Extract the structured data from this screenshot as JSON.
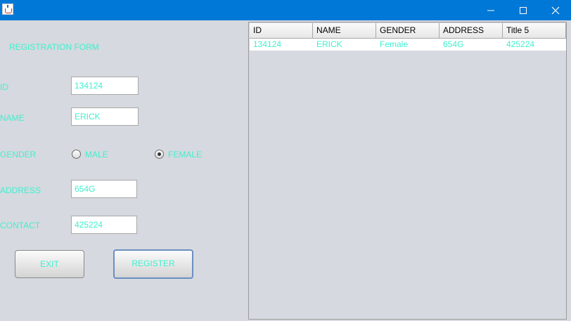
{
  "window": {
    "icons": {
      "app": "java-cup-icon",
      "minimize": "minimize-icon",
      "maximize": "maximize-icon",
      "close": "close-icon"
    }
  },
  "form": {
    "title": "REGISTRATION FORM",
    "id_label": "ID",
    "id_value": "134124",
    "name_label": "NAME",
    "name_value": "ERICK",
    "gender_label": "GENDER",
    "gender_options": [
      "MALE",
      "FEMALE"
    ],
    "gender_selected": "FEMALE",
    "address_label": "ADDRESS",
    "address_value": "654G",
    "contact_label": "CONTACT",
    "contact_value": "425224",
    "exit_label": "EXIT",
    "register_label": "REGISTER"
  },
  "table": {
    "columns": [
      "ID",
      "NAME",
      "GENDER",
      "ADDRESS",
      "Title 5"
    ],
    "rows": [
      [
        "134124",
        "ERICK",
        "Female",
        "654G",
        "425224"
      ]
    ]
  },
  "colors": {
    "titlebar": "#0078d7",
    "accent_text": "#3ff0cf",
    "background": "#d6d9df"
  }
}
